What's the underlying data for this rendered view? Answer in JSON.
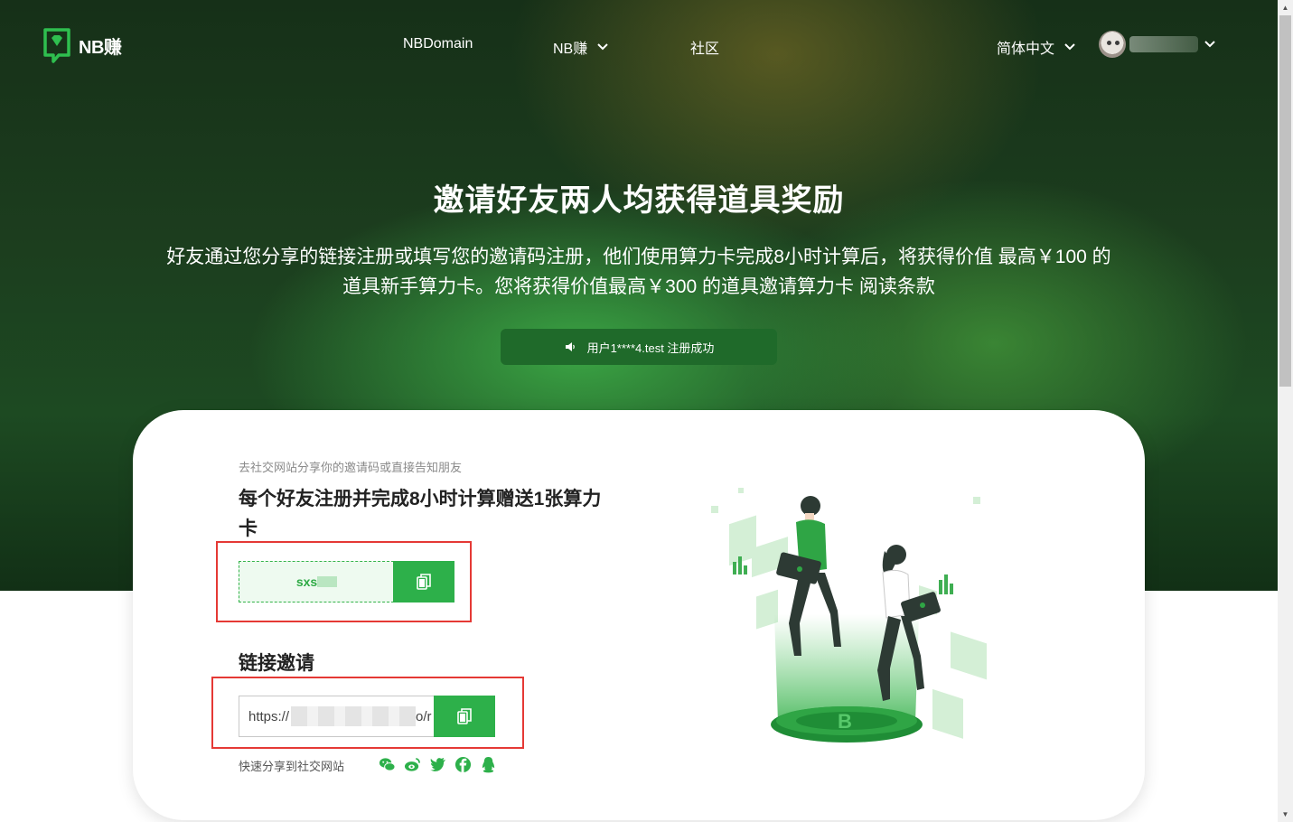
{
  "brand": {
    "name": "NB赚"
  },
  "nav": {
    "links": [
      "NBDomain",
      "NB赚",
      "社区"
    ],
    "language": "简体中文"
  },
  "hero": {
    "title": "邀请好友两人均获得道具奖励",
    "description_line1": "好友通过您分享的链接注册或填写您的邀请码注册，他们使用算力卡完成8小时计算后，将获得价值 最高￥100 的",
    "description_line2": "道具新手算力卡。您将获得价值最高￥300 的道具邀请算力卡 阅读条款",
    "notice": "用户1****4.test 注册成功"
  },
  "invite_card": {
    "hint": "去社交网站分享你的邀请码或直接告知朋友",
    "headline": "每个好友注册并完成8小时计算赠送1张算力卡",
    "invite_code_visible": "sxs",
    "link_section_title": "链接邀请",
    "link_prefix": "https://",
    "link_suffix": "o/r",
    "share_label": "快速分享到社交网站",
    "share_icons": [
      "wechat-icon",
      "weibo-icon",
      "twitter-icon",
      "facebook-icon",
      "qq-icon"
    ]
  },
  "colors": {
    "accent": "#2db04a",
    "highlight_border": "#e53935",
    "hero_dark": "#163018"
  }
}
